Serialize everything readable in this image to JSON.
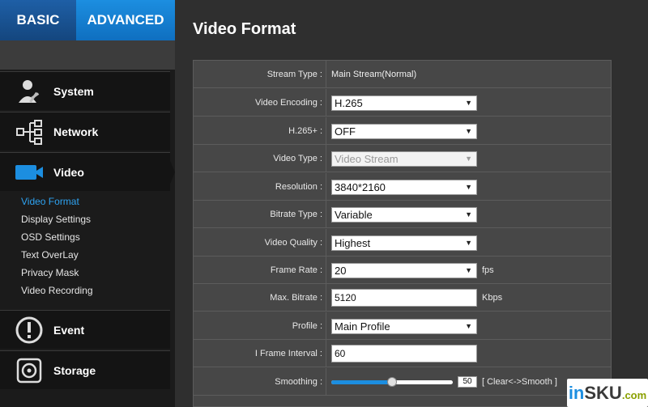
{
  "tabs": {
    "basic": "BASIC",
    "advanced": "ADVANCED"
  },
  "nav": {
    "system": "System",
    "network": "Network",
    "video": "Video",
    "event": "Event",
    "storage": "Storage"
  },
  "submenu": [
    "Video Format",
    "Display Settings",
    "OSD Settings",
    "Text OverLay",
    "Privacy Mask",
    "Video Recording"
  ],
  "page_title": "Video Format",
  "form": {
    "stream_type": {
      "label": "Stream Type :",
      "value": "Main Stream(Normal)"
    },
    "video_encoding": {
      "label": "Video Encoding :",
      "value": "H.265"
    },
    "h265plus": {
      "label": "H.265+ :",
      "value": "OFF"
    },
    "video_type": {
      "label": "Video Type :",
      "value": "Video Stream"
    },
    "resolution": {
      "label": "Resolution :",
      "value": "3840*2160"
    },
    "bitrate_type": {
      "label": "Bitrate Type :",
      "value": "Variable"
    },
    "video_quality": {
      "label": "Video Quality :",
      "value": "Highest"
    },
    "frame_rate": {
      "label": "Frame Rate :",
      "value": "20",
      "unit": "fps"
    },
    "max_bitrate": {
      "label": "Max. Bitrate :",
      "value": "5120",
      "unit": "Kbps"
    },
    "profile": {
      "label": "Profile :",
      "value": "Main Profile"
    },
    "i_frame_interval": {
      "label": "I Frame Interval :",
      "value": "60"
    },
    "smoothing": {
      "label": "Smoothing :",
      "value": "50",
      "fraction": 0.5,
      "hint": "[ Clear<->Smooth ]"
    }
  },
  "watermark": {
    "part1": "in",
    "part2": "SKU",
    "part3": ".com"
  },
  "colors": {
    "accent": "#1c8ee0",
    "panel": "#474747",
    "sidebar": "#141414"
  }
}
